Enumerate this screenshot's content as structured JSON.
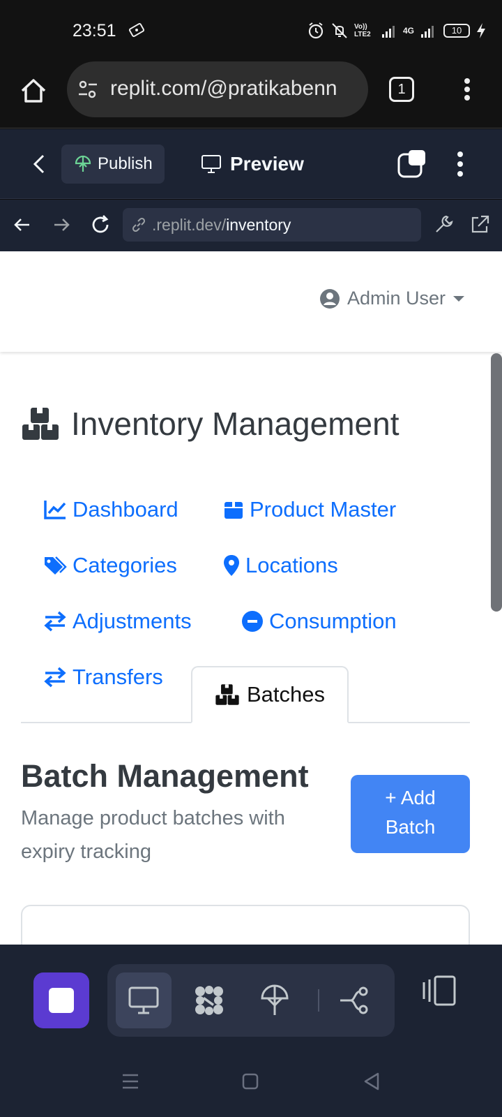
{
  "status_bar": {
    "time": "23:51",
    "network_label": "Vo)) LTE2",
    "signal_label": "4G",
    "battery": "10"
  },
  "browser": {
    "url": "replit.com/@pratikabenn",
    "tab_count": "1"
  },
  "replit_toolbar": {
    "publish_label": "Publish",
    "preview_label": "Preview"
  },
  "webview": {
    "url_muted": ".replit.dev/",
    "url_path": "inventory"
  },
  "app": {
    "user_menu_label": "Admin User",
    "page_title": "Inventory Management",
    "nav": {
      "dashboard": "Dashboard",
      "product_master": "Product Master",
      "categories": "Categories",
      "locations": "Locations",
      "adjustments": "Adjustments",
      "consumption": "Consumption",
      "transfers": "Transfers",
      "batches": "Batches"
    },
    "section_title": "Batch Management",
    "section_subtitle": "Manage product batches with expiry tracking",
    "add_button_line1": "+ Add",
    "add_button_line2": "Batch"
  },
  "colors": {
    "link": "#0d6efd",
    "primary_button": "#4285f4",
    "replit_panel": "#1c2333",
    "stop_button": "#5b3bd1"
  }
}
